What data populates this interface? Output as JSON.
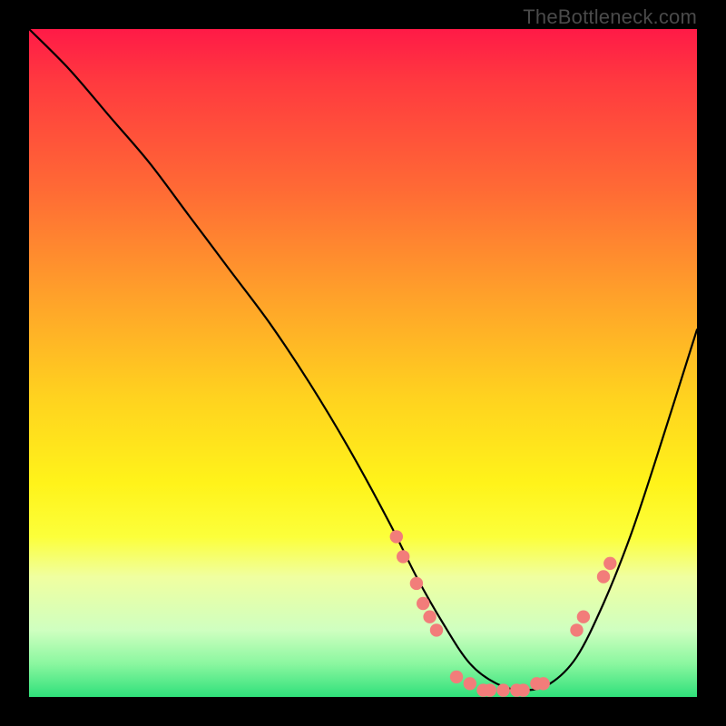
{
  "attribution": "TheBottleneck.com",
  "colors": {
    "dot": "#f27d7a",
    "curve": "#000000",
    "top": "#ff1a47",
    "bottom": "#2fe07a"
  },
  "chart_data": {
    "type": "line",
    "title": "",
    "xlabel": "",
    "ylabel": "",
    "xlim": [
      0,
      100
    ],
    "ylim": [
      0,
      100
    ],
    "grid": false,
    "legend": false,
    "series": [
      {
        "name": "bottleneck-curve",
        "x": [
          0,
          6,
          12,
          18,
          24,
          30,
          36,
          42,
          48,
          54,
          58,
          62,
          66,
          70,
          74,
          78,
          82,
          86,
          90,
          94,
          100
        ],
        "y": [
          100,
          94,
          87,
          80,
          72,
          64,
          56,
          47,
          37,
          26,
          18,
          11,
          5,
          2,
          1,
          2,
          6,
          14,
          24,
          36,
          55
        ]
      }
    ],
    "points": [
      {
        "name": "pt-1",
        "x": 55,
        "y": 24
      },
      {
        "name": "pt-2",
        "x": 56,
        "y": 21
      },
      {
        "name": "pt-3",
        "x": 58,
        "y": 17
      },
      {
        "name": "pt-4",
        "x": 59,
        "y": 14
      },
      {
        "name": "pt-5",
        "x": 60,
        "y": 12
      },
      {
        "name": "pt-6",
        "x": 61,
        "y": 10
      },
      {
        "name": "pt-7",
        "x": 64,
        "y": 3
      },
      {
        "name": "pt-8",
        "x": 66,
        "y": 2
      },
      {
        "name": "pt-9",
        "x": 68,
        "y": 1
      },
      {
        "name": "pt-10",
        "x": 69,
        "y": 1
      },
      {
        "name": "pt-11",
        "x": 71,
        "y": 1
      },
      {
        "name": "pt-12",
        "x": 73,
        "y": 1
      },
      {
        "name": "pt-13",
        "x": 74,
        "y": 1
      },
      {
        "name": "pt-14",
        "x": 76,
        "y": 2
      },
      {
        "name": "pt-15",
        "x": 77,
        "y": 2
      },
      {
        "name": "pt-16",
        "x": 82,
        "y": 10
      },
      {
        "name": "pt-17",
        "x": 83,
        "y": 12
      },
      {
        "name": "pt-18",
        "x": 86,
        "y": 18
      },
      {
        "name": "pt-19",
        "x": 87,
        "y": 20
      }
    ]
  }
}
